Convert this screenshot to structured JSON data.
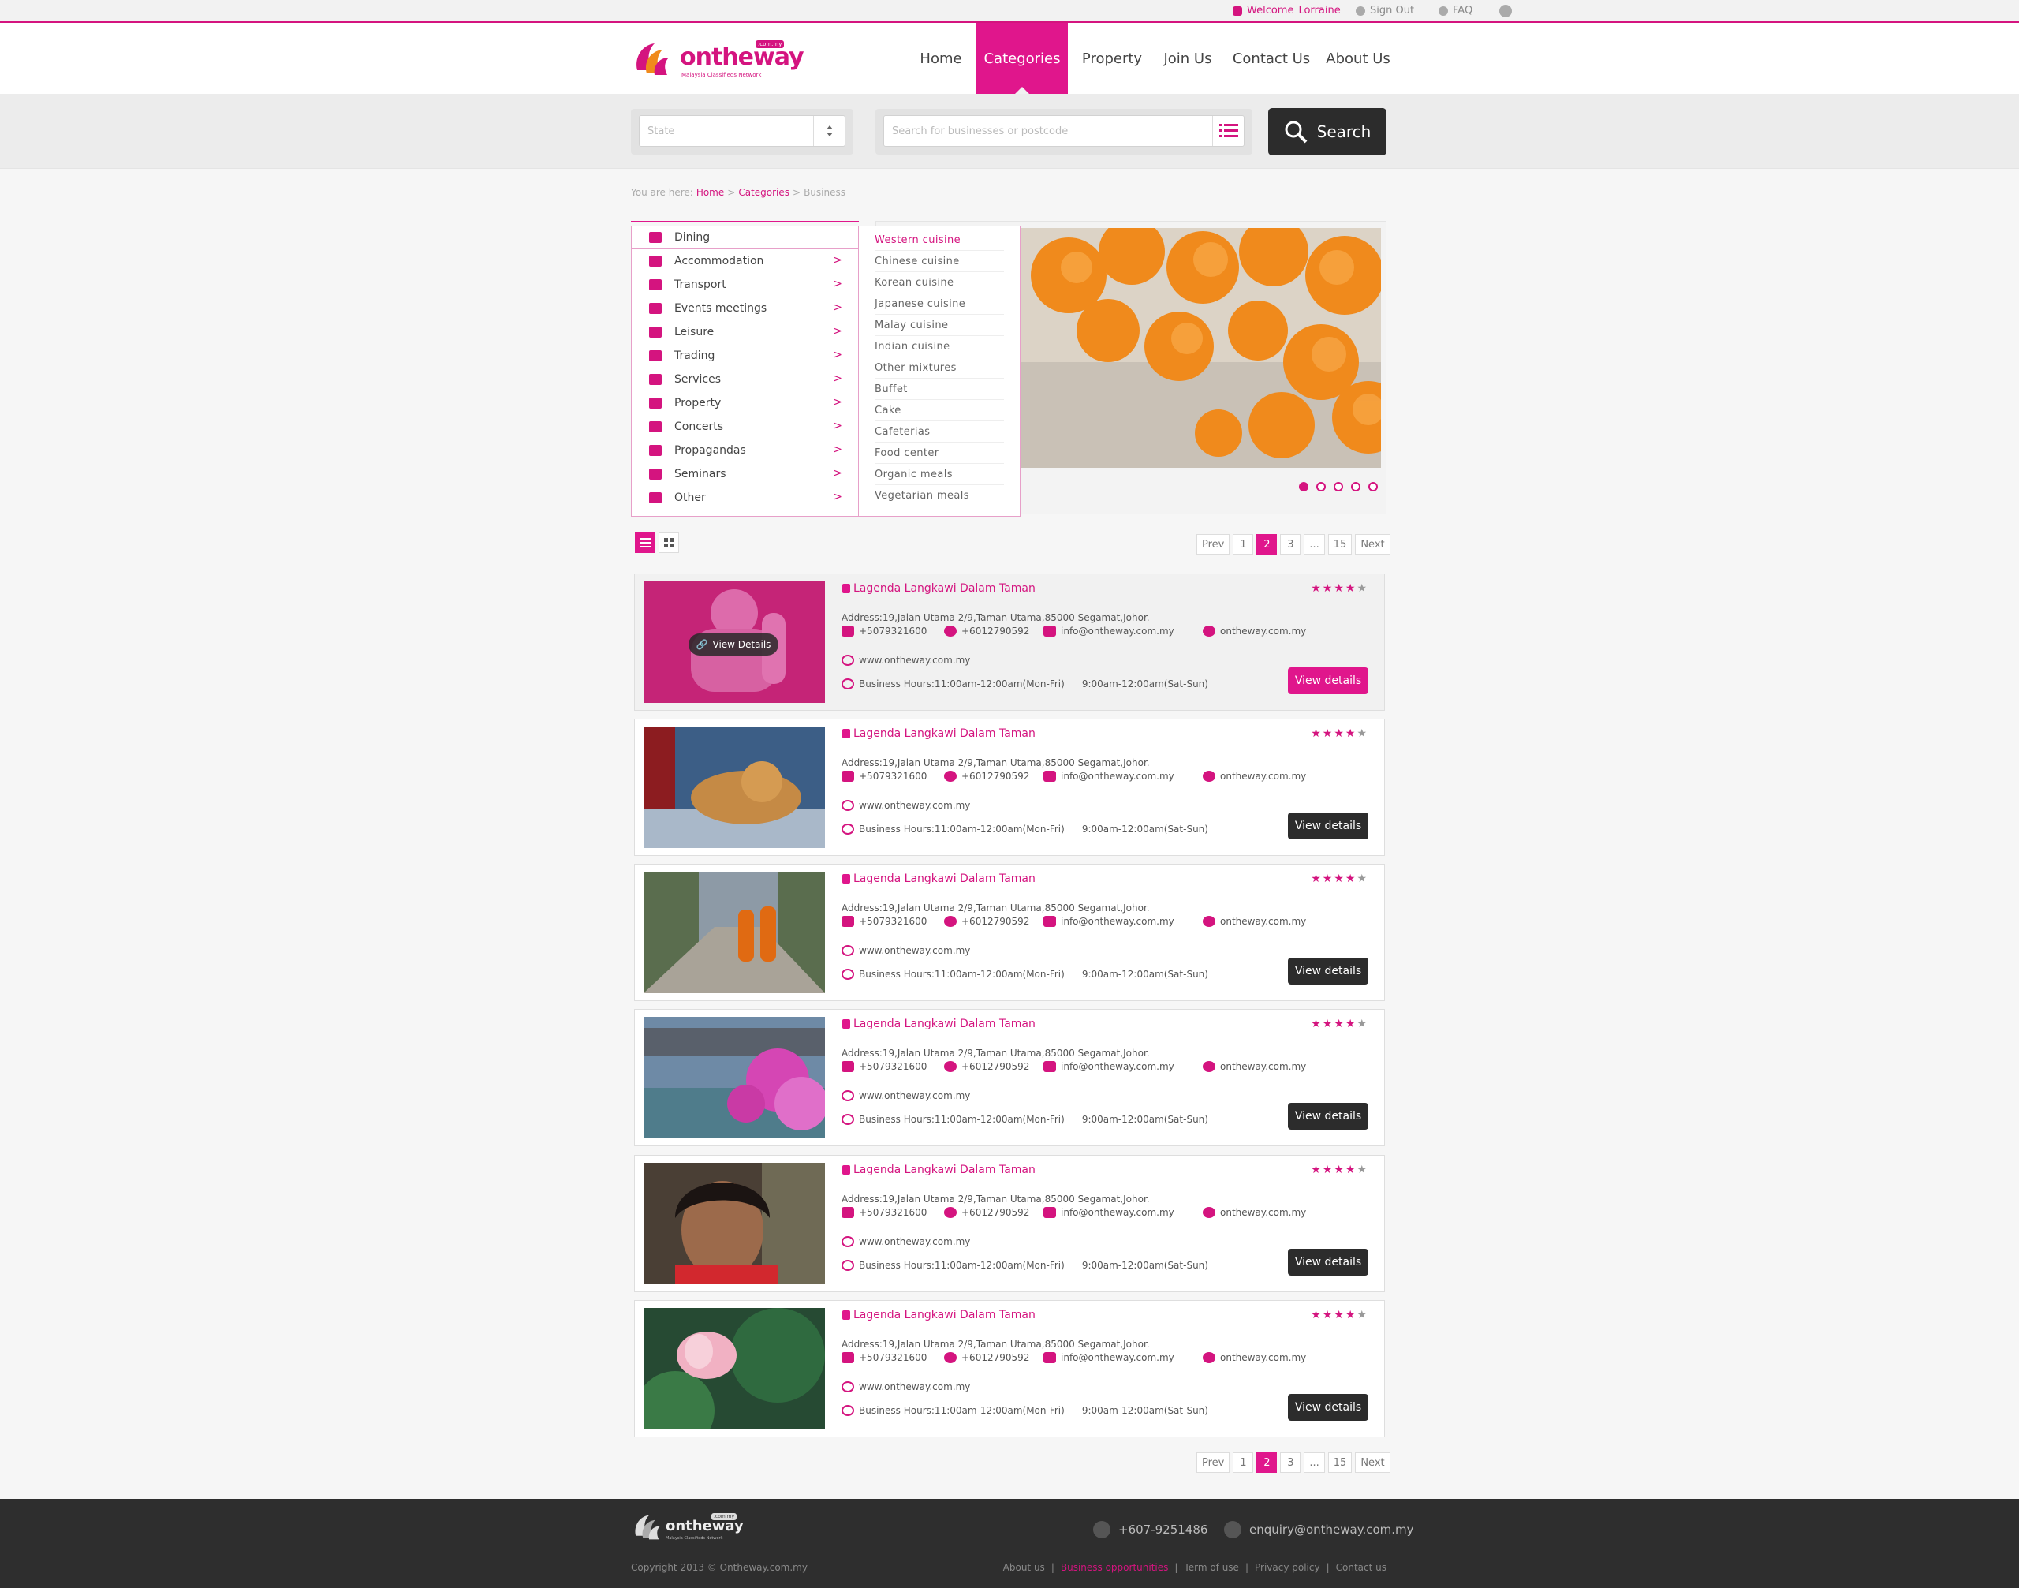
{
  "topbar": {
    "welcome_label": "Welcome",
    "user_name": "Lorraine",
    "sign_out": "Sign Out",
    "faq": "FAQ"
  },
  "logo": {
    "name": "ontheway",
    "tagline": "Malaysia Classifieds Network",
    "domain_badge": ".com.my"
  },
  "nav": {
    "items": [
      "Home",
      "Categories",
      "Property",
      "Join Us",
      "Contact Us",
      "About Us"
    ],
    "active": "Categories"
  },
  "search": {
    "state_placeholder": "State",
    "query_placeholder": "Search for businesses or postcode",
    "button_label": "Search"
  },
  "breadcrumb": {
    "prefix": "You are here:",
    "items": [
      "Home",
      "Categories",
      "Business"
    ]
  },
  "categories": {
    "items": [
      "Dining",
      "Accommodation",
      "Transport",
      "Events meetings",
      "Leisure",
      "Trading",
      "Services",
      "Property",
      "Concerts",
      "Propagandas",
      "Seminars",
      "Other"
    ],
    "selected": "Dining"
  },
  "subcategories": {
    "items": [
      "Western cuisine",
      "Chinese cuisine",
      "Korean cuisine",
      "Japanese cuisine",
      "Malay cuisine",
      "Indian cuisine",
      "Other mixtures",
      "Buffet",
      "Cake",
      "Cafeterias",
      "Food center",
      "Organic meals",
      "Vegetarian meals"
    ],
    "highlighted": "Western cuisine"
  },
  "slider": {
    "slide_count": 5,
    "active_index": 0
  },
  "pagination": {
    "prev": "Prev",
    "pages": [
      "1",
      "2",
      "3",
      "...",
      "15"
    ],
    "current": "2",
    "next": "Next"
  },
  "listings": [
    {
      "title": "Lagenda Langkawi Dalam Taman",
      "rating": 4,
      "max_rating": 5,
      "address": "Address:19,Jalan  Utama 2/9,Taman Utama,85000 Segamat,Johor.",
      "fax": "+5079321600",
      "phone": "+6012790592",
      "email": "info@ontheway.com.my",
      "facebook": "ontheway.com.my",
      "website": "www.ontheway.com.my",
      "hours_weekday": "Business Hours:11:00am-12:00am(Mon-Fri)",
      "hours_weekend": "9:00am-12:00am(Sat-Sun)",
      "button_label": "View details",
      "overlay_label": "View Details"
    },
    {
      "title": "Lagenda Langkawi Dalam Taman",
      "rating": 4,
      "max_rating": 5,
      "address": "Address:19,Jalan  Utama 2/9,Taman Utama,85000 Segamat,Johor.",
      "fax": "+5079321600",
      "phone": "+6012790592",
      "email": "info@ontheway.com.my",
      "facebook": "ontheway.com.my",
      "website": "www.ontheway.com.my",
      "hours_weekday": "Business Hours:11:00am-12:00am(Mon-Fri)",
      "hours_weekend": "9:00am-12:00am(Sat-Sun)",
      "button_label": "View details"
    },
    {
      "title": "Lagenda Langkawi Dalam Taman",
      "rating": 4,
      "max_rating": 5,
      "address": "Address:19,Jalan  Utama 2/9,Taman Utama,85000 Segamat,Johor.",
      "fax": "+5079321600",
      "phone": "+6012790592",
      "email": "info@ontheway.com.my",
      "facebook": "ontheway.com.my",
      "website": "www.ontheway.com.my",
      "hours_weekday": "Business Hours:11:00am-12:00am(Mon-Fri)",
      "hours_weekend": "9:00am-12:00am(Sat-Sun)",
      "button_label": "View details"
    },
    {
      "title": "Lagenda Langkawi Dalam Taman",
      "rating": 4,
      "max_rating": 5,
      "address": "Address:19,Jalan  Utama 2/9,Taman Utama,85000 Segamat,Johor.",
      "fax": "+5079321600",
      "phone": "+6012790592",
      "email": "info@ontheway.com.my",
      "facebook": "ontheway.com.my",
      "website": "www.ontheway.com.my",
      "hours_weekday": "Business Hours:11:00am-12:00am(Mon-Fri)",
      "hours_weekend": "9:00am-12:00am(Sat-Sun)",
      "button_label": "View details"
    },
    {
      "title": "Lagenda Langkawi Dalam Taman",
      "rating": 4,
      "max_rating": 5,
      "address": "Address:19,Jalan  Utama 2/9,Taman Utama,85000 Segamat,Johor.",
      "fax": "+5079321600",
      "phone": "+6012790592",
      "email": "info@ontheway.com.my",
      "facebook": "ontheway.com.my",
      "website": "www.ontheway.com.my",
      "hours_weekday": "Business Hours:11:00am-12:00am(Mon-Fri)",
      "hours_weekend": "9:00am-12:00am(Sat-Sun)",
      "button_label": "View details"
    },
    {
      "title": "Lagenda Langkawi Dalam Taman",
      "rating": 4,
      "max_rating": 5,
      "address": "Address:19,Jalan  Utama 2/9,Taman Utama,85000 Segamat,Johor.",
      "fax": "+5079321600",
      "phone": "+6012790592",
      "email": "info@ontheway.com.my",
      "facebook": "ontheway.com.my",
      "website": "www.ontheway.com.my",
      "hours_weekday": "Business Hours:11:00am-12:00am(Mon-Fri)",
      "hours_weekend": "9:00am-12:00am(Sat-Sun)",
      "button_label": "View details"
    }
  ],
  "footer": {
    "phone": "+607-9251486",
    "email": "enquiry@ontheway.com.my",
    "copyright": "Copyright 2013 © Ontheway.com.my",
    "links": [
      "About us",
      "Business opportunities",
      "Term of use",
      "Privacy policy",
      "Contact us"
    ],
    "highlighted_link": "Business opportunities"
  },
  "colors": {
    "brand": "#e0168c",
    "dark": "#2c2c2c",
    "footer": "#2e2e2e"
  }
}
